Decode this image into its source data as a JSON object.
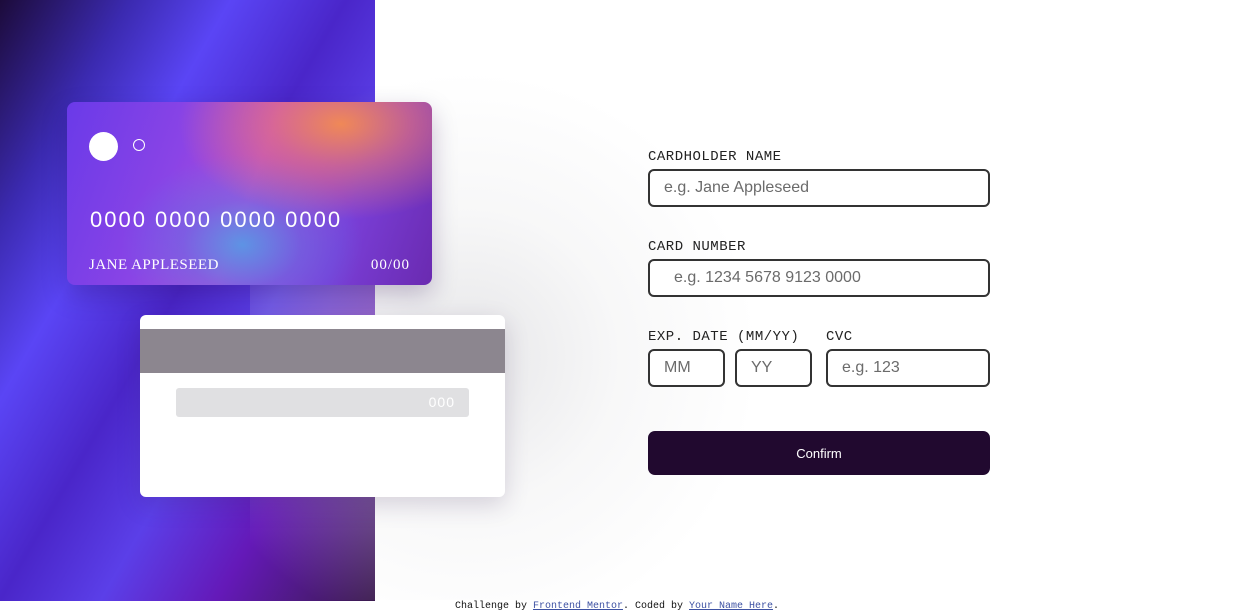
{
  "card_front": {
    "number": "0000 0000 0000 0000",
    "name": "JANE APPLESEED",
    "expiry": "00/00"
  },
  "card_back": {
    "cvc": "000"
  },
  "form": {
    "name_label": "CARDHOLDER NAME",
    "name_placeholder": "e.g. Jane Appleseed",
    "number_label": "CARD NUMBER",
    "number_placeholder": "e.g. 1234 5678 9123 0000",
    "exp_label": "EXP. DATE (MM/YY)",
    "mm_placeholder": "MM",
    "yy_placeholder": "YY",
    "cvc_label": "CVC",
    "cvc_placeholder": "e.g. 123",
    "confirm_label": "Confirm"
  },
  "footer": {
    "prefix": "Challenge by ",
    "link1": "Frontend Mentor",
    "middle": ". Coded by ",
    "link2": "Your Name Here",
    "suffix": "."
  },
  "colors": {
    "button_bg": "#21092f",
    "input_border": "#333333",
    "panel_accent": "#5a45f5"
  }
}
